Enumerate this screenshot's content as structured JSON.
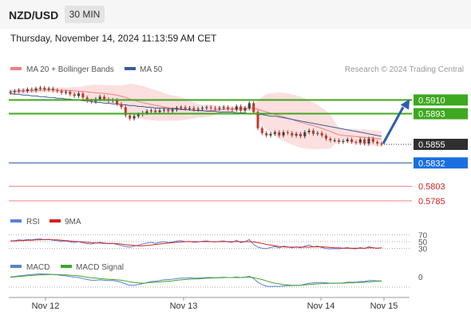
{
  "header": {
    "pair": "NZD/USD",
    "timeframe": "30 MIN"
  },
  "datetime": "Thursday, November 14, 2024 11:13:59 AM CET",
  "main_legend": {
    "ma20_label": "MA 20 + Bollinger Bands",
    "ma50_label": "MA 50",
    "ma20_color": "#f08080",
    "ma50_color": "#3a5e95",
    "credit": "Research © 2024 Trading Central"
  },
  "rsi_legend": {
    "rsi_label": "RSI",
    "ma_label": "9MA",
    "rsi_color": "#5b7fd8",
    "ma_color": "#d62020"
  },
  "macd_legend": {
    "macd_label": "MACD",
    "signal_label": "MACD Signal",
    "macd_color": "#5b7fd8",
    "signal_color": "#3ea82a"
  },
  "chart_data": {
    "type": "candlestick",
    "y_range": [
      0.5772,
      0.594
    ],
    "x_ticks": [
      "Nov 12",
      "Nov 13",
      "Nov 14",
      "Nov 15"
    ],
    "last_price": 0.5855,
    "resistance_levels": [
      0.591,
      0.5893
    ],
    "support_level": 0.5832,
    "lower_levels": [
      0.5803,
      0.5785
    ],
    "level_labels": {
      "r1": "0.5910",
      "r2": "0.5893",
      "last": "0.5855",
      "s1": "0.5832",
      "l1": "0.5803",
      "l2": "0.5785"
    },
    "closes": [
      0.592,
      0.5921,
      0.5922,
      0.5921,
      0.5923,
      0.5922,
      0.5924,
      0.5925,
      0.5923,
      0.5924,
      0.5922,
      0.5921,
      0.5919,
      0.592,
      0.5917,
      0.5915,
      0.5918,
      0.5913,
      0.5909,
      0.5908,
      0.5911,
      0.5914,
      0.5911,
      0.5909,
      0.591,
      0.5905,
      0.5901,
      0.5891,
      0.5887,
      0.589,
      0.5892,
      0.5894,
      0.5896,
      0.5897,
      0.5895,
      0.5897,
      0.5898,
      0.5896,
      0.5898,
      0.59,
      0.5901,
      0.5899,
      0.59,
      0.5898,
      0.5899,
      0.59,
      0.5901,
      0.59,
      0.5899,
      0.59,
      0.5901,
      0.5899,
      0.5898,
      0.5902,
      0.5897,
      0.59,
      0.5906,
      0.5895,
      0.5875,
      0.5869,
      0.5866,
      0.5868,
      0.587,
      0.5866,
      0.587,
      0.5869,
      0.5866,
      0.5868,
      0.5865,
      0.587,
      0.5872,
      0.5868,
      0.5869,
      0.5866,
      0.5862,
      0.586,
      0.586,
      0.5858,
      0.5859,
      0.5861,
      0.5858,
      0.5857,
      0.5861,
      0.5856,
      0.5862,
      0.5858,
      0.5856,
      0.5855
    ],
    "ma50": [
      0.5918,
      0.5917,
      0.5917,
      0.5916,
      0.5916,
      0.5915,
      0.5915,
      0.5914,
      0.5914,
      0.5913,
      0.5913,
      0.5912,
      0.5912,
      0.5911,
      0.5911,
      0.591,
      0.591,
      0.5909,
      0.5909,
      0.5908,
      0.5907,
      0.5907,
      0.5906,
      0.5906,
      0.5905,
      0.5905,
      0.5904,
      0.5904,
      0.5903,
      0.5903,
      0.5902,
      0.5902,
      0.5901,
      0.5901,
      0.59,
      0.59,
      0.59,
      0.5899,
      0.5899,
      0.5899,
      0.5898,
      0.5898,
      0.5898,
      0.5897,
      0.5897,
      0.5897,
      0.5896,
      0.5896,
      0.5896,
      0.5895,
      0.5895,
      0.5895,
      0.5895,
      0.5894,
      0.5894,
      0.5894,
      0.5893,
      0.5893,
      0.5892,
      0.5892,
      0.5891,
      0.589,
      0.589,
      0.5889,
      0.5888,
      0.5887,
      0.5886,
      0.5885,
      0.5884,
      0.5883,
      0.5882,
      0.5881,
      0.588,
      0.5879,
      0.5878,
      0.5877,
      0.5876,
      0.5875,
      0.5874,
      0.5873,
      0.5872,
      0.5871,
      0.587,
      0.5869,
      0.5868,
      0.5867,
      0.5866,
      0.5865
    ],
    "rsi": [
      52,
      53,
      55,
      54,
      56,
      55,
      57,
      58,
      55,
      57,
      54,
      53,
      51,
      52,
      49,
      47,
      50,
      46,
      44,
      43,
      46,
      48,
      46,
      44,
      45,
      42,
      39,
      36,
      34,
      37,
      40,
      43,
      46,
      48,
      45,
      48,
      50,
      47,
      49,
      52,
      53,
      50,
      51,
      48,
      49,
      51,
      52,
      50,
      49,
      51,
      52,
      49,
      48,
      54,
      47,
      50,
      56,
      42,
      34,
      31,
      30,
      33,
      36,
      32,
      37,
      35,
      32,
      35,
      32,
      37,
      40,
      35,
      37,
      33,
      30,
      29,
      30,
      29,
      31,
      33,
      30,
      29,
      33,
      30,
      36,
      32,
      31,
      32
    ],
    "rsi_ma": [
      52,
      52,
      53,
      53,
      54,
      54,
      55,
      55,
      56,
      56,
      55,
      55,
      54,
      53,
      52,
      51,
      50,
      49,
      48,
      47,
      46,
      46,
      45,
      45,
      45,
      44,
      43,
      41,
      40,
      39,
      38,
      38,
      39,
      40,
      42,
      43,
      45,
      46,
      47,
      48,
      49,
      50,
      50,
      50,
      50,
      50,
      50,
      50,
      50,
      50,
      50,
      50,
      50,
      50,
      50,
      50,
      50,
      49,
      47,
      45,
      42,
      40,
      38,
      36,
      35,
      34,
      34,
      34,
      34,
      34,
      34,
      35,
      35,
      35,
      34,
      33,
      32,
      32,
      31,
      31,
      31,
      31,
      31,
      31,
      32,
      32,
      31,
      32
    ],
    "rsi_levels": [
      70,
      50,
      30
    ],
    "macd": [
      0.2,
      0.3,
      0.5,
      0.6,
      0.8,
      0.9,
      1.0,
      1.1,
      1.0,
      1.0,
      0.9,
      0.8,
      0.6,
      0.5,
      0.3,
      0.1,
      0.0,
      -0.3,
      -0.6,
      -0.8,
      -0.8,
      -0.7,
      -0.8,
      -0.9,
      -0.9,
      -1.1,
      -1.4,
      -1.9,
      -2.3,
      -2.3,
      -2.1,
      -1.8,
      -1.5,
      -1.2,
      -1.1,
      -0.9,
      -0.7,
      -0.6,
      -0.5,
      -0.3,
      -0.2,
      -0.2,
      -0.1,
      -0.2,
      -0.2,
      -0.1,
      0.0,
      0.0,
      -0.1,
      0.0,
      0.1,
      0.0,
      0.0,
      0.2,
      0.0,
      0.1,
      0.4,
      -0.3,
      -1.4,
      -2.1,
      -2.6,
      -2.7,
      -2.6,
      -2.7,
      -2.5,
      -2.4,
      -2.4,
      -2.3,
      -2.3,
      -2.0,
      -1.7,
      -1.6,
      -1.5,
      -1.5,
      -1.6,
      -1.7,
      -1.7,
      -1.7,
      -1.6,
      -1.4,
      -1.4,
      -1.4,
      -1.2,
      -1.2,
      -0.9,
      -0.9,
      -1.0,
      -1.0
    ],
    "macd_signal": [
      0.1,
      0.2,
      0.3,
      0.4,
      0.5,
      0.6,
      0.7,
      0.8,
      0.8,
      0.9,
      0.9,
      0.9,
      0.8,
      0.8,
      0.7,
      0.6,
      0.5,
      0.3,
      0.1,
      -0.1,
      -0.2,
      -0.3,
      -0.4,
      -0.5,
      -0.6,
      -0.7,
      -0.8,
      -1.0,
      -1.3,
      -1.5,
      -1.6,
      -1.7,
      -1.6,
      -1.5,
      -1.4,
      -1.3,
      -1.2,
      -1.1,
      -1.0,
      -0.8,
      -0.7,
      -0.6,
      -0.5,
      -0.4,
      -0.4,
      -0.3,
      -0.2,
      -0.2,
      -0.1,
      -0.1,
      0.0,
      0.0,
      0.0,
      0.0,
      0.0,
      0.1,
      0.1,
      0.0,
      -0.3,
      -0.6,
      -1.0,
      -1.4,
      -1.7,
      -1.9,
      -2.1,
      -2.2,
      -2.3,
      -2.3,
      -2.3,
      -2.2,
      -2.1,
      -2.0,
      -1.9,
      -1.8,
      -1.8,
      -1.7,
      -1.7,
      -1.7,
      -1.7,
      -1.6,
      -1.6,
      -1.5,
      -1.5,
      -1.4,
      -1.3,
      -1.2,
      -1.1,
      -1.1
    ],
    "macd_zero_label": "0",
    "rsi_level_labels": [
      "70",
      "50",
      "30"
    ]
  }
}
